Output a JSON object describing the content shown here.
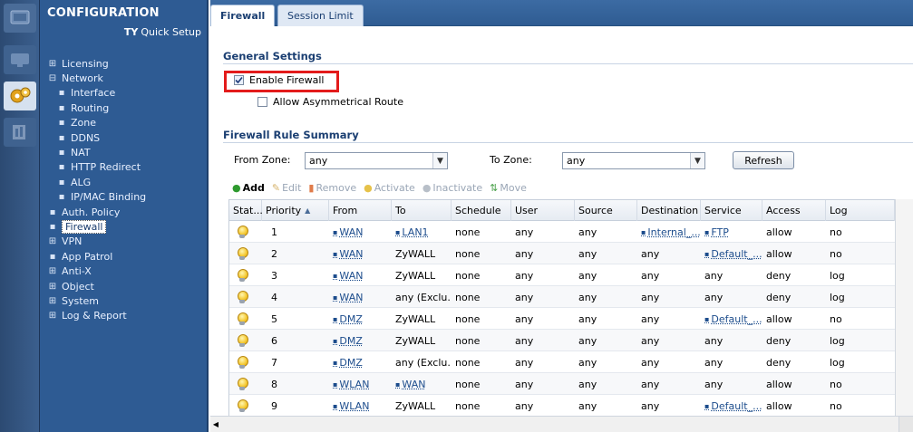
{
  "nav": {
    "title": "CONFIGURATION",
    "quick_setup": "Quick Setup",
    "items": [
      {
        "glyph": "⊞",
        "label": "Licensing",
        "sub": false
      },
      {
        "glyph": "⊟",
        "label": "Network",
        "sub": false
      },
      {
        "glyph": "▪",
        "label": "Interface",
        "sub": true
      },
      {
        "glyph": "▪",
        "label": "Routing",
        "sub": true
      },
      {
        "glyph": "▪",
        "label": "Zone",
        "sub": true
      },
      {
        "glyph": "▪",
        "label": "DDNS",
        "sub": true
      },
      {
        "glyph": "▪",
        "label": "NAT",
        "sub": true
      },
      {
        "glyph": "▪",
        "label": "HTTP Redirect",
        "sub": true
      },
      {
        "glyph": "▪",
        "label": "ALG",
        "sub": true
      },
      {
        "glyph": "▪",
        "label": "IP/MAC Binding",
        "sub": true
      },
      {
        "glyph": "▪",
        "label": "Auth. Policy",
        "sub": false
      },
      {
        "glyph": "▪",
        "label": "Firewall",
        "sub": false,
        "selected": true
      },
      {
        "glyph": "⊞",
        "label": "VPN",
        "sub": false
      },
      {
        "glyph": "▪",
        "label": "App Patrol",
        "sub": false
      },
      {
        "glyph": "⊞",
        "label": "Anti-X",
        "sub": false
      },
      {
        "glyph": "⊞",
        "label": "Object",
        "sub": false
      },
      {
        "glyph": "⊞",
        "label": "System",
        "sub": false
      },
      {
        "glyph": "⊞",
        "label": "Log & Report",
        "sub": false
      }
    ]
  },
  "tabs": [
    {
      "label": "Firewall",
      "active": true
    },
    {
      "label": "Session Limit",
      "active": false
    }
  ],
  "general": {
    "title": "General Settings",
    "enable_firewall": {
      "label": "Enable Firewall",
      "checked": true
    },
    "allow_asym": {
      "label": "Allow Asymmetrical Route",
      "checked": false
    }
  },
  "summary": {
    "title": "Firewall Rule Summary",
    "from_zone_label": "From Zone:",
    "from_zone_value": "any",
    "to_zone_label": "To Zone:",
    "to_zone_value": "any",
    "refresh": "Refresh"
  },
  "toolbar": {
    "add": "Add",
    "edit": "Edit",
    "remove": "Remove",
    "activate": "Activate",
    "inactivate": "Inactivate",
    "move": "Move"
  },
  "table": {
    "columns": [
      "Stat...",
      "Priority",
      "From",
      "To",
      "Schedule",
      "User",
      "Source",
      "Destination",
      "Service",
      "Access",
      "Log"
    ],
    "rows": [
      {
        "priority": "1",
        "from": "WAN",
        "from_obj": true,
        "to": "LAN1",
        "to_obj": true,
        "schedule": "none",
        "user": "any",
        "source": "any",
        "destination": "Internal_...",
        "dest_obj": true,
        "service": "FTP",
        "service_obj": true,
        "access": "allow",
        "log": "no"
      },
      {
        "priority": "2",
        "from": "WAN",
        "from_obj": true,
        "to": "ZyWALL",
        "to_obj": false,
        "schedule": "none",
        "user": "any",
        "source": "any",
        "destination": "any",
        "dest_obj": false,
        "service": "Default_...",
        "service_obj": true,
        "access": "allow",
        "log": "no"
      },
      {
        "priority": "3",
        "from": "WAN",
        "from_obj": true,
        "to": "ZyWALL",
        "to_obj": false,
        "schedule": "none",
        "user": "any",
        "source": "any",
        "destination": "any",
        "dest_obj": false,
        "service": "any",
        "service_obj": false,
        "access": "deny",
        "log": "log"
      },
      {
        "priority": "4",
        "from": "WAN",
        "from_obj": true,
        "to": "any (Exclu...",
        "to_obj": false,
        "schedule": "none",
        "user": "any",
        "source": "any",
        "destination": "any",
        "dest_obj": false,
        "service": "any",
        "service_obj": false,
        "access": "deny",
        "log": "log"
      },
      {
        "priority": "5",
        "from": "DMZ",
        "from_obj": true,
        "to": "ZyWALL",
        "to_obj": false,
        "schedule": "none",
        "user": "any",
        "source": "any",
        "destination": "any",
        "dest_obj": false,
        "service": "Default_...",
        "service_obj": true,
        "access": "allow",
        "log": "no"
      },
      {
        "priority": "6",
        "from": "DMZ",
        "from_obj": true,
        "to": "ZyWALL",
        "to_obj": false,
        "schedule": "none",
        "user": "any",
        "source": "any",
        "destination": "any",
        "dest_obj": false,
        "service": "any",
        "service_obj": false,
        "access": "deny",
        "log": "log"
      },
      {
        "priority": "7",
        "from": "DMZ",
        "from_obj": true,
        "to": "any (Exclu...",
        "to_obj": false,
        "schedule": "none",
        "user": "any",
        "source": "any",
        "destination": "any",
        "dest_obj": false,
        "service": "any",
        "service_obj": false,
        "access": "deny",
        "log": "log"
      },
      {
        "priority": "8",
        "from": "WLAN",
        "from_obj": true,
        "to": "WAN",
        "to_obj": true,
        "schedule": "none",
        "user": "any",
        "source": "any",
        "destination": "any",
        "dest_obj": false,
        "service": "any",
        "service_obj": false,
        "access": "allow",
        "log": "no"
      },
      {
        "priority": "9",
        "from": "WLAN",
        "from_obj": true,
        "to": "ZyWALL",
        "to_obj": false,
        "schedule": "none",
        "user": "any",
        "source": "any",
        "destination": "any",
        "dest_obj": false,
        "service": "Default_...",
        "service_obj": true,
        "access": "allow",
        "log": "no"
      }
    ]
  },
  "colors": {
    "nav_bg": "#2e5b93",
    "accent": "#1b3f72",
    "highlight": "#e31b1b"
  }
}
